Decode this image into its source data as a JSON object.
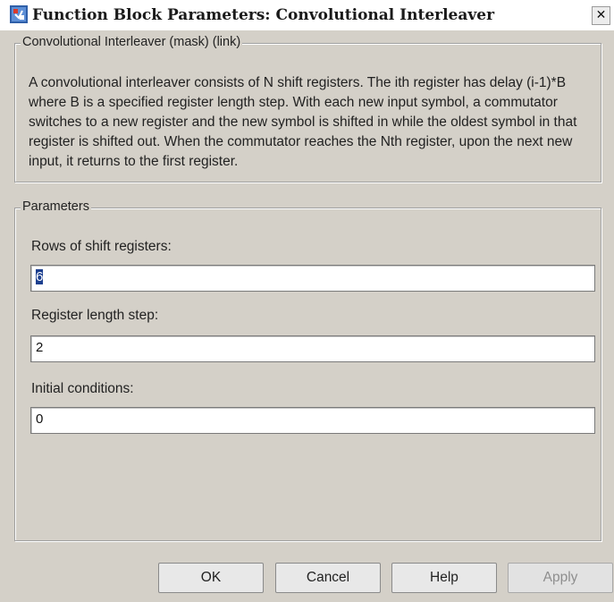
{
  "window": {
    "title": "Function Block Parameters: Convolutional Interleaver",
    "close_glyph": "✕",
    "icon": "simulink-block-icon"
  },
  "description_group": {
    "legend": "Convolutional Interleaver (mask) (link)",
    "text": "A convolutional interleaver consists of N shift registers.  The ith register has delay (i-1)*B where B is a specified register length step.  With each new input symbol, a commutator switches to a new register and the new symbol is shifted in while the oldest symbol in that register is shifted out.  When the commutator reaches the Nth register, upon the next new input, it returns to the first register."
  },
  "parameters_group": {
    "legend": "Parameters",
    "fields": [
      {
        "label": "Rows of shift registers:",
        "value": "6",
        "selected": true
      },
      {
        "label": "Register length step:",
        "value": "2",
        "selected": false
      },
      {
        "label": "Initial conditions:",
        "value": "0",
        "selected": false
      }
    ]
  },
  "buttons": {
    "ok": "OK",
    "cancel": "Cancel",
    "help": "Help",
    "apply": "Apply",
    "apply_enabled": false
  }
}
